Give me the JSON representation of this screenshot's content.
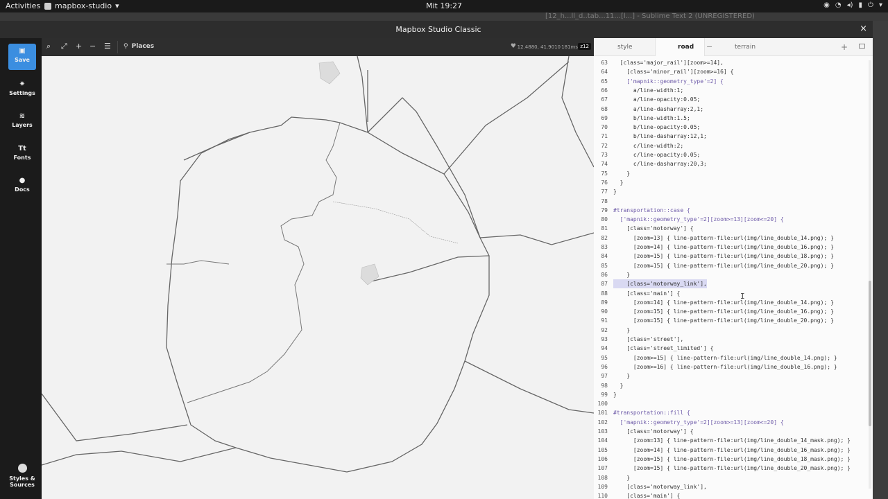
{
  "system": {
    "activities": "Activities",
    "app_name": "mapbox-studio",
    "clock": "Mit 19:27",
    "background_window_text": "[12_h...ll_d..tab...11...[l...] - Sublime Text 2 (UNREGISTERED)"
  },
  "window": {
    "title": "Mapbox Studio Classic",
    "close": "×"
  },
  "sidebar": {
    "items": [
      {
        "label": "Save",
        "icon": "save-icon"
      },
      {
        "label": "Settings",
        "icon": "gear-icon"
      },
      {
        "label": "Layers",
        "icon": "layers-icon"
      },
      {
        "label": "Fonts",
        "icon": "fonts-icon"
      },
      {
        "label": "Docs",
        "icon": "info-icon"
      }
    ],
    "bottom": {
      "label_line1": "Styles &",
      "label_line2": "Sources"
    }
  },
  "map_toolbar": {
    "places_label": "Places",
    "coords": "12.4880, 41.9010",
    "render_time": "181ms",
    "zoom": "z12"
  },
  "editor": {
    "tabs": [
      {
        "label": "style",
        "active": false
      },
      {
        "label": "road",
        "active": true
      },
      {
        "label": "terrain",
        "active": false
      }
    ],
    "lines": [
      {
        "n": "63",
        "t": "  [class='major_rail'][zoom>=14],"
      },
      {
        "n": "64",
        "t": "    [class='minor_rail'][zoom>=16] {"
      },
      {
        "n": "65",
        "t": "    ['mapnik::geometry_type'=2] {"
      },
      {
        "n": "66",
        "t": "      a/line-width:1;"
      },
      {
        "n": "67",
        "t": "      a/line-opacity:0.05;"
      },
      {
        "n": "68",
        "t": "      a/line-dasharray:2,1;"
      },
      {
        "n": "69",
        "t": "      b/line-width:1.5;"
      },
      {
        "n": "70",
        "t": "      b/line-opacity:0.05;"
      },
      {
        "n": "71",
        "t": "      b/line-dasharray:12,1;"
      },
      {
        "n": "72",
        "t": "      c/line-width:2;"
      },
      {
        "n": "73",
        "t": "      c/line-opacity:0.05;"
      },
      {
        "n": "74",
        "t": "      c/line-dasharray:20,3;"
      },
      {
        "n": "75",
        "t": "    }"
      },
      {
        "n": "76",
        "t": "  }"
      },
      {
        "n": "77",
        "t": "}"
      },
      {
        "n": "78",
        "t": ""
      },
      {
        "n": "79",
        "t": "#transportation::case {"
      },
      {
        "n": "80",
        "t": "  ['mapnik::geometry_type'=2][zoom>=13][zoom<=20] {"
      },
      {
        "n": "81",
        "t": "    [class='motorway'] {"
      },
      {
        "n": "82",
        "t": "      [zoom=13] { line-pattern-file:url(img/line_double_14.png); }"
      },
      {
        "n": "83",
        "t": "      [zoom=14] { line-pattern-file:url(img/line_double_16.png); }"
      },
      {
        "n": "84",
        "t": "      [zoom=15] { line-pattern-file:url(img/line_double_18.png); }"
      },
      {
        "n": "85",
        "t": "      [zoom=15] { line-pattern-file:url(img/line_double_20.png); }"
      },
      {
        "n": "86",
        "t": "    }"
      },
      {
        "n": "87",
        "t": "    [class='motorway_link'],",
        "highlight": true
      },
      {
        "n": "88",
        "t": "    [class='main'] {"
      },
      {
        "n": "89",
        "t": "      [zoom=14] { line-pattern-file:url(img/line_double_14.png); }"
      },
      {
        "n": "90",
        "t": "      [zoom=15] { line-pattern-file:url(img/line_double_16.png); }"
      },
      {
        "n": "91",
        "t": "      [zoom=15] { line-pattern-file:url(img/line_double_20.png); }"
      },
      {
        "n": "92",
        "t": "    }"
      },
      {
        "n": "93",
        "t": "    [class='street'],"
      },
      {
        "n": "94",
        "t": "    [class='street_limited'] {"
      },
      {
        "n": "95",
        "t": "      [zoom>=15] { line-pattern-file:url(img/line_double_14.png); }"
      },
      {
        "n": "96",
        "t": "      [zoom>=16] { line-pattern-file:url(img/line_double_16.png); }"
      },
      {
        "n": "97",
        "t": "    }"
      },
      {
        "n": "98",
        "t": "  }"
      },
      {
        "n": "99",
        "t": "}"
      },
      {
        "n": "100",
        "t": ""
      },
      {
        "n": "101",
        "t": "#transportation::fill {"
      },
      {
        "n": "102",
        "t": "  ['mapnik::geometry_type'=2][zoom>=13][zoom<=20] {"
      },
      {
        "n": "103",
        "t": "    [class='motorway'] {"
      },
      {
        "n": "104",
        "t": "      [zoom=13] { line-pattern-file:url(img/line_double_14_mask.png); }"
      },
      {
        "n": "105",
        "t": "      [zoom=14] { line-pattern-file:url(img/line_double_16_mask.png); }"
      },
      {
        "n": "106",
        "t": "      [zoom=15] { line-pattern-file:url(img/line_double_18_mask.png); }"
      },
      {
        "n": "107",
        "t": "      [zoom=15] { line-pattern-file:url(img/line_double_20_mask.png); }"
      },
      {
        "n": "108",
        "t": "    }"
      },
      {
        "n": "109",
        "t": "    [class='motorway_link'],"
      },
      {
        "n": "110",
        "t": "    [class='main'] {"
      }
    ]
  },
  "colors": {
    "accent": "#3b8ee0",
    "sidebar": "#1b1b1b",
    "map_bg": "#f2f2f2",
    "editor_bg": "#fbfbfb"
  }
}
